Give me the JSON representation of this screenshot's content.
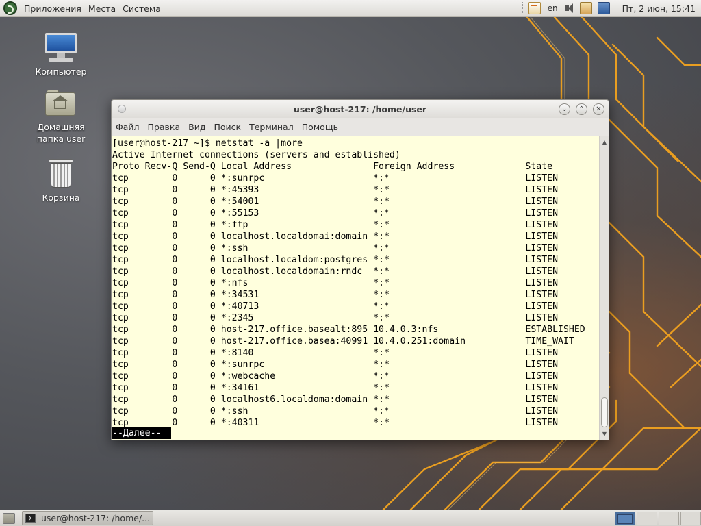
{
  "top_panel": {
    "menus": [
      "Приложения",
      "Места",
      "Система"
    ],
    "lang": "en",
    "clock": "Пт, 2 июн, 15:41",
    "icons": [
      "distro-menu-icon",
      "notes-icon",
      "volume-icon",
      "clipboard-icon",
      "network-icon"
    ]
  },
  "desktop": {
    "icons": [
      {
        "label": "Компьютер",
        "icon": "computer-icon"
      },
      {
        "label": "Домашняя папка user",
        "icon": "home-folder-icon"
      },
      {
        "label": "Корзина",
        "icon": "trash-icon"
      }
    ]
  },
  "terminal": {
    "title": "user@host-217: /home/user",
    "menu": [
      "Файл",
      "Правка",
      "Вид",
      "Поиск",
      "Терминал",
      "Помощь"
    ],
    "lines": [
      "[user@host-217 ~]$ netstat -a |more",
      "Active Internet connections (servers and established)",
      "Proto Recv-Q Send-Q Local Address               Foreign Address             State",
      "tcp        0      0 *:sunrpc                    *:*                         LISTEN",
      "tcp        0      0 *:45393                     *:*                         LISTEN",
      "tcp        0      0 *:54001                     *:*                         LISTEN",
      "tcp        0      0 *:55153                     *:*                         LISTEN",
      "tcp        0      0 *:ftp                       *:*                         LISTEN",
      "tcp        0      0 localhost.localdomai:domain *:*                         LISTEN",
      "tcp        0      0 *:ssh                       *:*                         LISTEN",
      "tcp        0      0 localhost.localdom:postgres *:*                         LISTEN",
      "tcp        0      0 localhost.localdomain:rndc  *:*                         LISTEN",
      "tcp        0      0 *:nfs                       *:*                         LISTEN",
      "tcp        0      0 *:34531                     *:*                         LISTEN",
      "tcp        0      0 *:40713                     *:*                         LISTEN",
      "tcp        0      0 *:2345                      *:*                         LISTEN",
      "tcp        0      0 host-217.office.basealt:895 10.4.0.3:nfs                ESTABLISHED",
      "tcp        0      0 host-217.office.basea:40991 10.4.0.251:domain           TIME_WAIT",
      "tcp        0      0 *:8140                      *:*                         LISTEN",
      "tcp        0      0 *:sunrpc                    *:*                         LISTEN",
      "tcp        0      0 *:webcache                  *:*                         LISTEN",
      "tcp        0      0 *:34161                     *:*                         LISTEN",
      "tcp        0      0 localhost6.localdoma:domain *:*                         LISTEN",
      "tcp        0      0 *:ssh                       *:*                         LISTEN",
      "tcp        0      0 *:40311                     *:*                         LISTEN"
    ],
    "more_prompt": "--Далее--",
    "window_buttons": [
      "minimize",
      "maximize",
      "close"
    ]
  },
  "taskbar": {
    "task_label": "user@host-217: /home/..."
  },
  "colors": {
    "terminal_bg": "#ffffdd",
    "panel_bg": "#dcdad5",
    "wallpaper_accent": "#f0a020"
  }
}
